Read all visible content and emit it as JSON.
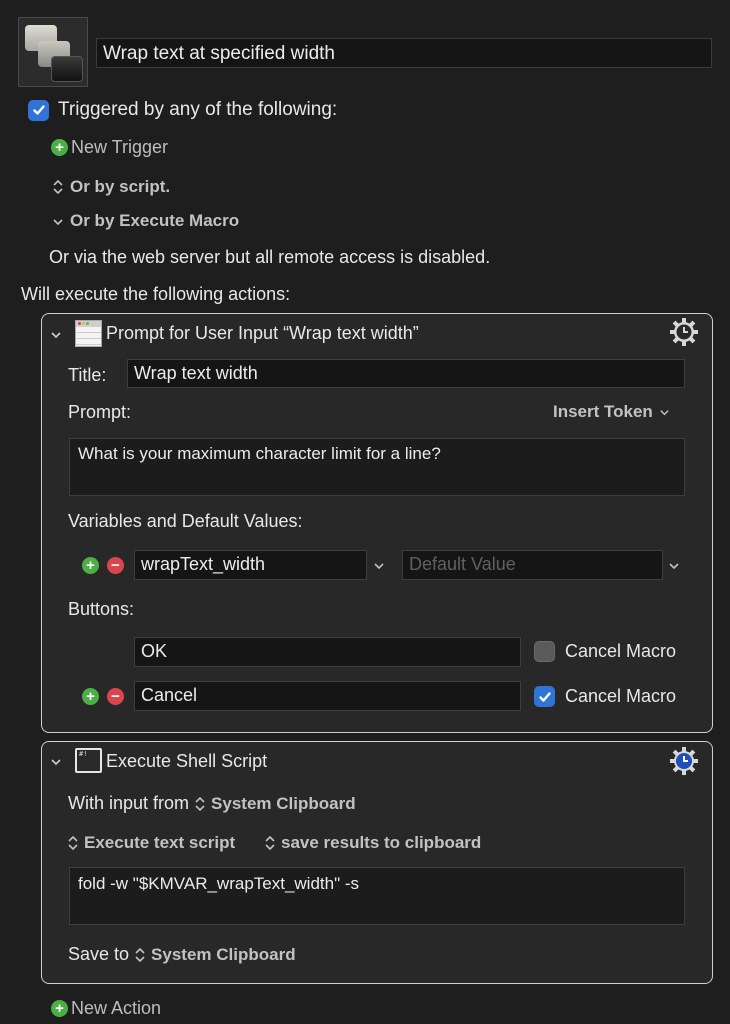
{
  "macro": {
    "icon": "macro-keys-icon",
    "name": "Wrap text at specified width"
  },
  "triggers": {
    "enabled": true,
    "label": "Triggered by any of the following:",
    "new_trigger_label": "New Trigger",
    "or_by_script_label": "Or by script.",
    "or_by_execute_macro_label": "Or by Execute Macro",
    "web_server_note": "Or via the web server but all remote access is disabled."
  },
  "actions_heading": "Will execute the following actions:",
  "actions": [
    {
      "type": "prompt-for-user-input",
      "title": "Prompt for User Input “Wrap text width”",
      "icon": "window-icon",
      "gear_color": "#d8d8d8",
      "title_label": "Title:",
      "title_value": "Wrap text width",
      "prompt_label": "Prompt:",
      "insert_token_label": "Insert Token",
      "prompt_value": "What is your maximum character limit for a line?",
      "variables_label": "Variables and Default Values:",
      "variables": [
        {
          "name": "wrapText_width",
          "default_placeholder": "Default Value",
          "default_value": ""
        }
      ],
      "buttons_label": "Buttons:",
      "buttons": [
        {
          "label": "OK",
          "cancel_macro": false,
          "cancel_macro_label": "Cancel Macro"
        },
        {
          "label": "Cancel",
          "cancel_macro": true,
          "cancel_macro_label": "Cancel Macro"
        }
      ]
    },
    {
      "type": "execute-shell-script",
      "title": "Execute Shell Script",
      "icon": "terminal-icon",
      "gear_color": "#1f4fb8",
      "with_input_label": "With input from",
      "with_input_value": "System Clipboard",
      "execute_mode": "Execute text script",
      "results_mode": "save results to clipboard",
      "script": "fold -w \"$KMVAR_wrapText_width\" -s",
      "save_to_label": "Save to",
      "save_to_value": "System Clipboard"
    }
  ],
  "new_action_label": "New Action",
  "colors": {
    "background": "#1e1e1e",
    "panel": "#282828",
    "accent_blue": "#2f74d6",
    "add_green": "#4caf45",
    "remove_red": "#d9464e"
  }
}
